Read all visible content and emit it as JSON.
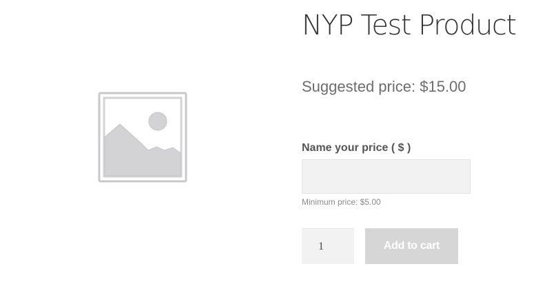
{
  "product": {
    "title": "NYP Test Product",
    "suggested_price": "Suggested price: $15.00",
    "image_icon": "image-placeholder-icon"
  },
  "nyp": {
    "label": "Name your price ( $ )",
    "input_value": "",
    "minimum_price": "Minimum price: $5.00"
  },
  "cart": {
    "quantity": "1",
    "add_to_cart_label": "Add to cart"
  },
  "colors": {
    "placeholder_gray": "#d3d3d6",
    "input_background": "#f2f2f2",
    "button_disabled": "#d6d6d6"
  }
}
